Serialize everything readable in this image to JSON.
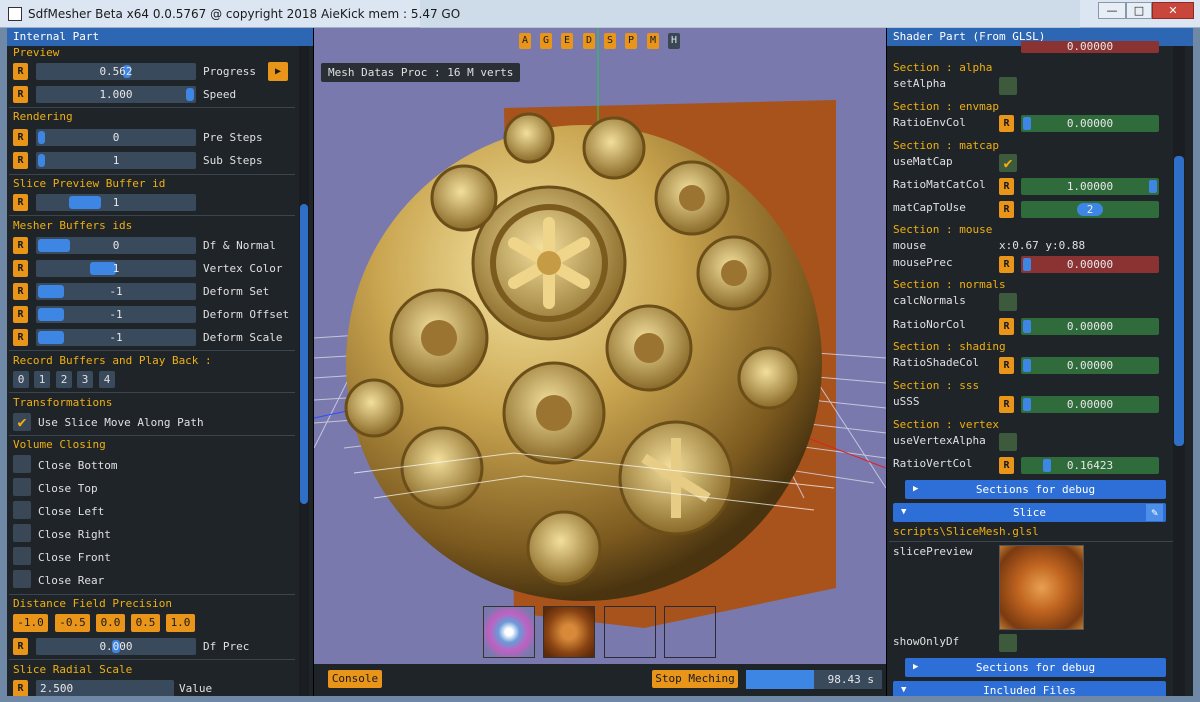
{
  "window": {
    "title": "SdfMesher Beta x64 0.0.5767 @ copyright 2018 AieKick mem : 5.47 GO",
    "minimize": "—",
    "maximize": "□",
    "close": "✕"
  },
  "left_panel": {
    "title": "Internal Part",
    "preview": {
      "section": "Preview",
      "progress_value": "0.562",
      "progress_label": "Progress",
      "speed_value": "1.000",
      "speed_label": "Speed"
    },
    "rendering": {
      "section": "Rendering",
      "pre_value": "0",
      "pre_label": "Pre Steps",
      "sub_value": "1",
      "sub_label": "Sub Steps"
    },
    "slice_preview": {
      "section": "Slice Preview Buffer id",
      "value": "1"
    },
    "mesher": {
      "section": "Mesher Buffers ids",
      "rows": [
        {
          "value": "0",
          "label": "Df & Normal"
        },
        {
          "value": "1",
          "label": "Vertex Color"
        },
        {
          "value": "-1",
          "label": "Deform Set"
        },
        {
          "value": "-1",
          "label": "Deform Offset"
        },
        {
          "value": "-1",
          "label": "Deform Scale"
        }
      ]
    },
    "record": {
      "section": "Record Buffers and Play Back :",
      "buttons": [
        "0",
        "1",
        "2",
        "3",
        "4"
      ]
    },
    "transformations": {
      "section": "Transformations",
      "checkbox": "Use Slice Move Along Path"
    },
    "volume": {
      "section": "Volume Closing",
      "items": [
        "Close Bottom",
        "Close Top",
        "Close Left",
        "Close Right",
        "Close Front",
        "Close Rear"
      ]
    },
    "df_precision": {
      "section": "Distance Field Precision",
      "buttons": [
        "-1.0",
        "-0.5",
        "0.0",
        "0.5",
        "1.0"
      ],
      "value": "0.000",
      "label": "Df Prec"
    },
    "radial": {
      "section": "Slice Radial Scale",
      "value": "2.500",
      "label": "Value"
    },
    "r": "R",
    "play": "▶"
  },
  "viewport": {
    "hud_buttons": [
      "A",
      "G",
      "E",
      "D",
      "S",
      "P",
      "M",
      "H"
    ],
    "mesh_info": "Mesh Datas Proc : 16 M verts",
    "console": "Console",
    "stop": "Stop Meching",
    "time": "98.43 s",
    "progress_fraction": 0.5
  },
  "right_panel": {
    "title": "Shader Part (From GLSL)",
    "top_value": "0.00000",
    "alpha": {
      "section": "Section : alpha",
      "label": "setAlpha"
    },
    "envmap": {
      "section": "Section : envmap",
      "label": "RatioEnvCol",
      "value": "0.00000"
    },
    "matcap": {
      "section": "Section : matcap",
      "use": "useMatCap",
      "ratio_label": "RatioMatCatCol",
      "ratio_value": "1.00000",
      "tex_label": "matCapToUse",
      "tex_value": "2"
    },
    "mouse": {
      "section": "Section : mouse",
      "label": "mouse",
      "coords": "x:0.67 y:0.88",
      "prec_label": "mousePrec",
      "prec_value": "0.00000"
    },
    "normals": {
      "section": "Section : normals",
      "calc": "calcNormals",
      "ratio_label": "RatioNorCol",
      "ratio_value": "0.00000"
    },
    "shading": {
      "section": "Section : shading",
      "label": "RatioShadeCol",
      "value": "0.00000"
    },
    "sss": {
      "section": "Section : sss",
      "label": "uSSS",
      "value": "0.00000"
    },
    "vertex": {
      "section": "Section : vertex",
      "use": "useVertexAlpha",
      "ratio_label": "RatioVertCol",
      "ratio_value": "0.16423"
    },
    "debug1": "Sections for debug",
    "slice_header": "Slice",
    "slice_file": "scripts\\SliceMesh.glsl",
    "slice_preview": "slicePreview",
    "show_only_df": "showOnlyDf",
    "debug2": "Sections for debug",
    "included": "Included Files",
    "r": "R"
  },
  "colors": {
    "accent_orange": "#e8951a",
    "title_blue": "#2d66b2",
    "section_yellow": "#f0b010",
    "viewport_bg": "#7a79ad"
  }
}
